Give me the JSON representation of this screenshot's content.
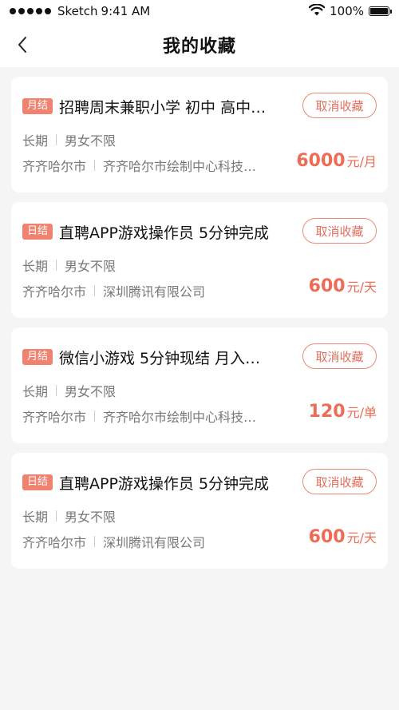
{
  "status_bar": {
    "carrier": "Sketch",
    "time": "9:41 AM",
    "battery": "100%"
  },
  "nav": {
    "title": "我的收藏"
  },
  "cards": [
    {
      "tag": "月结",
      "title": "招聘周末兼职小学 初中 高中…",
      "cancel_label": "取消收藏",
      "duration": "长期",
      "gender": "男女不限",
      "city": "齐齐哈尔市",
      "company": "齐齐哈尔市绘制中心科技…",
      "salary_amount": "6000",
      "salary_unit": "元/月"
    },
    {
      "tag": "日结",
      "title": "直聘APP游戏操作员 5分钟完成",
      "cancel_label": "取消收藏",
      "duration": "长期",
      "gender": "男女不限",
      "city": "齐齐哈尔市",
      "company": "深圳腾讯有限公司",
      "salary_amount": "600",
      "salary_unit": "元/天"
    },
    {
      "tag": "月结",
      "title": "微信小游戏 5分钟现结 月入…",
      "cancel_label": "取消收藏",
      "duration": "长期",
      "gender": "男女不限",
      "city": "齐齐哈尔市",
      "company": "齐齐哈尔市绘制中心科技…",
      "salary_amount": "120",
      "salary_unit": "元/单"
    },
    {
      "tag": "日结",
      "title": "直聘APP游戏操作员 5分钟完成",
      "cancel_label": "取消收藏",
      "duration": "长期",
      "gender": "男女不限",
      "city": "齐齐哈尔市",
      "company": "深圳腾讯有限公司",
      "salary_amount": "600",
      "salary_unit": "元/天"
    }
  ]
}
